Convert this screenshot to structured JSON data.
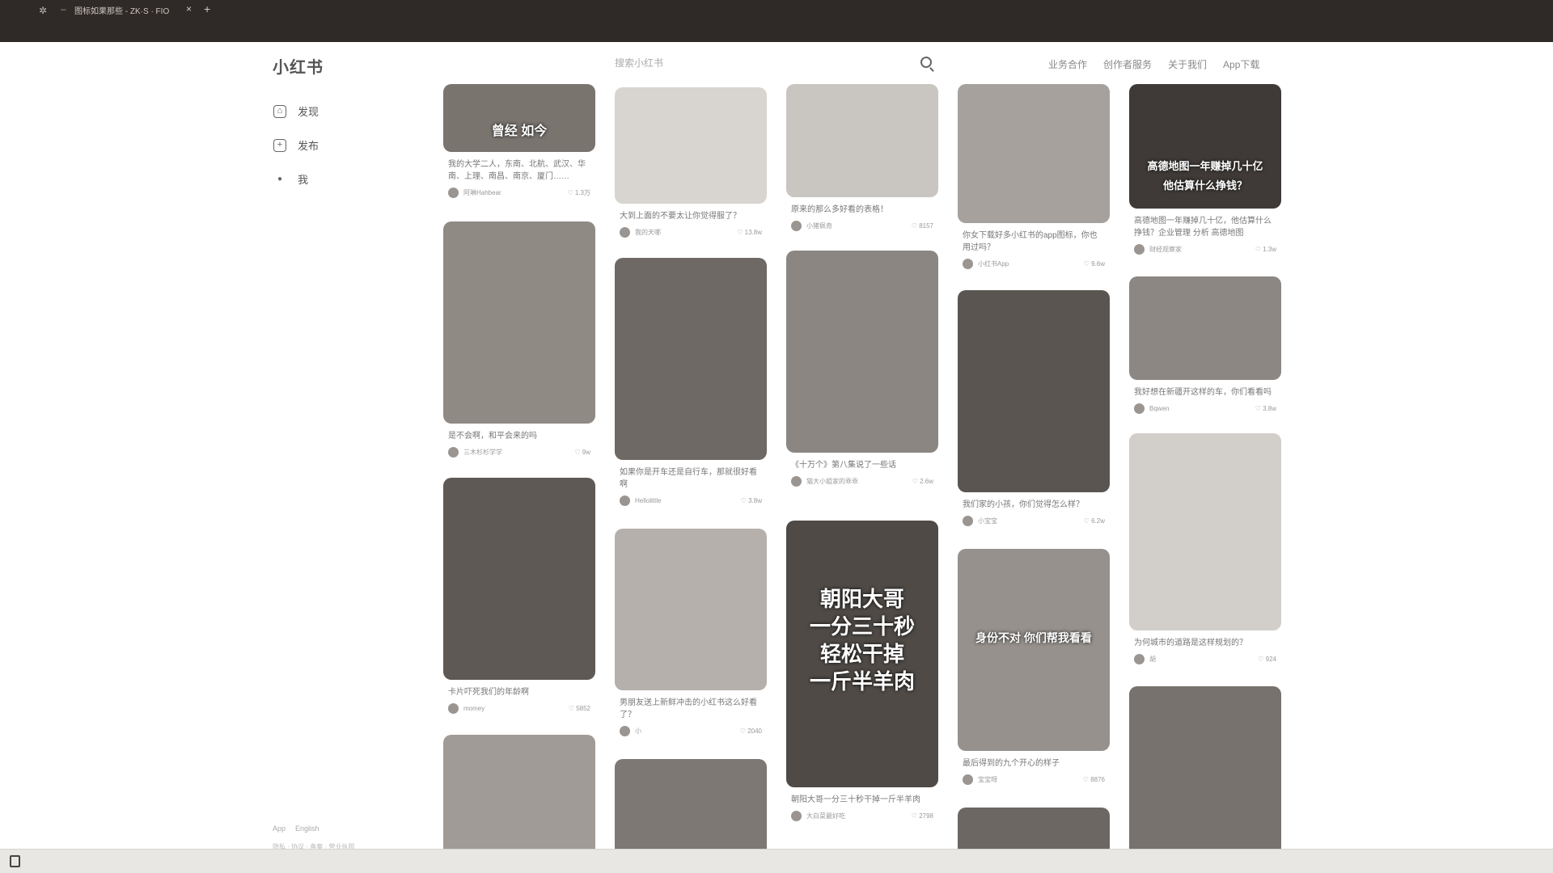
{
  "browser": {
    "tab_title": "图标如果那些 - ZK·S · FIO",
    "new_tab_symbol": "+",
    "close_symbol": "×"
  },
  "header": {
    "logo": "小红书",
    "search_placeholder": "搜索小红书",
    "nav": [
      "业务合作",
      "创作者服务",
      "关于我们",
      "App下载"
    ]
  },
  "sidebar": {
    "items": [
      {
        "label": "发现",
        "icon": "home-icon"
      },
      {
        "label": "发布",
        "icon": "plus-icon"
      },
      {
        "label": "我",
        "icon": "user-icon"
      }
    ],
    "footer_app": "App",
    "footer_lang": "English",
    "footer_links": "隐私 · 协议 · 备案 · 营业执照"
  },
  "feed": {
    "columns": [
      {
        "cards": [
          {
            "overlay": "曾经    如今",
            "caption": "我的大学二人，东南、北航、武汉、华南、上理、南昌、南京、厦门……",
            "author": "阿琳Hahbear",
            "likes": "1.3万",
            "img_color": "#7a746f"
          },
          {
            "overlay": "",
            "caption": "是不会啊，和平会来的吗",
            "author": "三木杉杉学学",
            "likes": "9w",
            "img_color": "#8f8a84"
          },
          {
            "overlay": "",
            "caption": "卡片吓死我们的年龄啊",
            "author": "momey",
            "likes": "5852",
            "img_color": "#5e5955"
          },
          {
            "overlay": "",
            "caption": "",
            "author": "",
            "likes": "",
            "img_color": "#a09b96"
          }
        ]
      },
      {
        "cards": [
          {
            "overlay": "",
            "caption": "大到上面的不要太让你觉得服了？",
            "author": "我的天哪",
            "likes": "13.8w",
            "img_color": "#d8d4d0"
          },
          {
            "overlay": "",
            "caption": "如果你是开车还是自行车，那就很好看啊",
            "author": "Hellolittle",
            "likes": "3.8w",
            "img_color": "#6e6964"
          },
          {
            "overlay": "",
            "caption": "男朋友送上新鲜冲击的小红书这么好看了？",
            "author": "小",
            "likes": "2040",
            "img_color": "#b5b0ab"
          },
          {
            "overlay": "",
            "caption": "",
            "author": "",
            "likes": "",
            "img_color": "#7d7873"
          }
        ]
      },
      {
        "cards": [
          {
            "overlay": "",
            "caption": "原来的那么多好看的表格！",
            "author": "小猪佩奇",
            "likes": "8157",
            "img_color": "#c9c5c1"
          },
          {
            "overlay": "",
            "caption": "《十万个》第八集说了一些话",
            "author": "猫大小姐家的乖乖",
            "likes": "2.6w",
            "img_color": "#8b8681"
          },
          {
            "overlay": "朝阳大哥\n一分三十秒\n轻松干掉\n一斤半羊肉",
            "caption": "朝阳大哥一分三十秒干掉一斤半羊肉",
            "author": "大白菜最好吃",
            "likes": "2798",
            "img_color": "#4f4a46"
          }
        ]
      },
      {
        "cards": [
          {
            "overlay": "",
            "caption": "你女下载好多小红书的app图标，你也用过吗？",
            "author": "小红书App",
            "likes": "9.6w",
            "img_color": "#a6a19c"
          },
          {
            "overlay": "",
            "caption": "我们家的小孩，你们觉得怎么样？",
            "author": "小宝宝",
            "likes": "6.2w",
            "img_color": "#5a5551"
          },
          {
            "overlay": "身份不对 你们帮我看看",
            "caption": "最后得到的九个开心的样子",
            "author": "宝宝呀",
            "likes": "8876",
            "img_color": "#96918c"
          },
          {
            "overlay": "",
            "caption": "",
            "author": "",
            "likes": "",
            "img_color": "#6c6762"
          }
        ]
      },
      {
        "cards": [
          {
            "overlay": "高德地图一年赚掉几十亿\n他估算什么挣钱？",
            "caption": "高德地图一年赚掉几十亿，他估算什么挣钱？企业管理 分析 高德地图",
            "author": "财经观察家",
            "likes": "1.3w",
            "img_color": "#3f3a37"
          },
          {
            "overlay": "",
            "caption": "我好想在新疆开这样的车，你们看看吗",
            "author": "Bqwen",
            "likes": "3.8w",
            "img_color": "#8c8782"
          },
          {
            "overlay": "",
            "caption": "为何城市的道路是这样规划的？",
            "author": "胡",
            "likes": "924",
            "img_color": "#d2ceca"
          },
          {
            "overlay": "",
            "caption": "",
            "author": "",
            "likes": "",
            "img_color": "#77726d"
          }
        ]
      }
    ]
  }
}
